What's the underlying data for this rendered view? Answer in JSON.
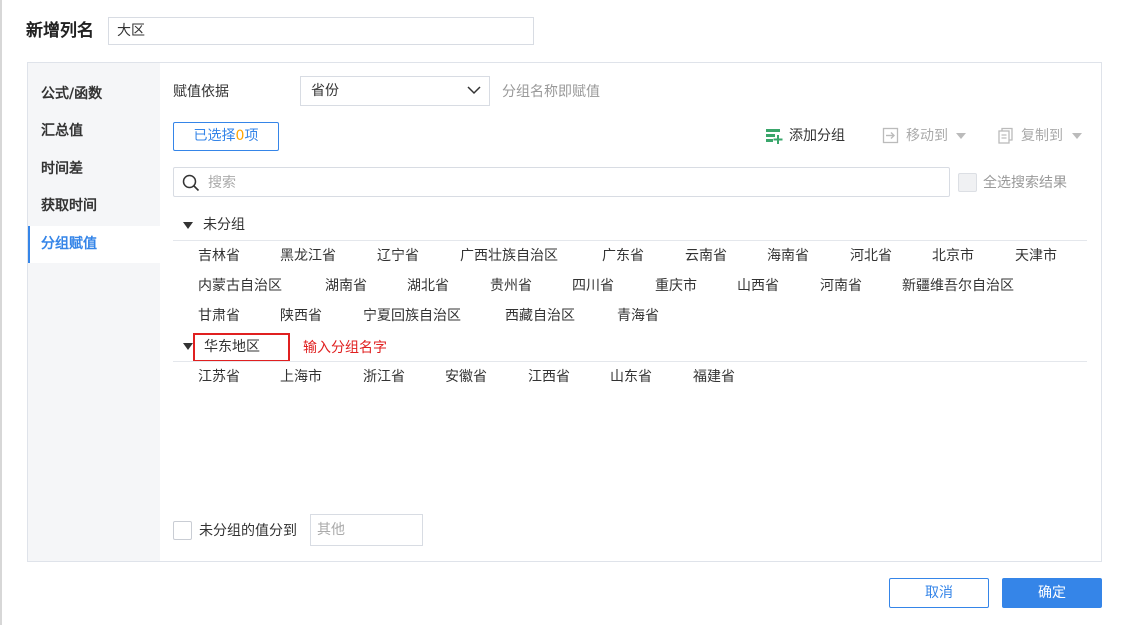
{
  "header": {
    "label": "新增列名",
    "name_value": "大区"
  },
  "sidebar": {
    "items": [
      {
        "label": "公式/函数"
      },
      {
        "label": "汇总值"
      },
      {
        "label": "时间差"
      },
      {
        "label": "获取时间"
      },
      {
        "label": "分组赋值"
      }
    ],
    "active_index": 4
  },
  "assign": {
    "basis_label": "赋值依据",
    "basis_value": "省份",
    "hint": "分组名称即赋值"
  },
  "toolbar": {
    "selected_prefix": "已选择",
    "selected_count": "0",
    "selected_suffix": "项",
    "add_group": "添加分组",
    "move_to": "移动到",
    "copy_to": "复制到"
  },
  "search": {
    "placeholder": "搜索",
    "select_all_results": "全选搜索结果"
  },
  "groups": [
    {
      "title": "未分组",
      "items": [
        "吉林省",
        "黑龙江省",
        "辽宁省",
        "广西壮族自治区",
        "广东省",
        "云南省",
        "海南省",
        "河北省",
        "北京市",
        "天津市",
        "内蒙古自治区",
        "湖南省",
        "湖北省",
        "贵州省",
        "四川省",
        "重庆市",
        "山西省",
        "河南省",
        "新疆维吾尔自治区",
        "甘肃省",
        "陕西省",
        "宁夏回族自治区",
        "西藏自治区",
        "青海省"
      ]
    },
    {
      "title": "华东地区",
      "annotation": "输入分组名字",
      "items": [
        "江苏省",
        "上海市",
        "浙江省",
        "安徽省",
        "江西省",
        "山东省",
        "福建省"
      ]
    }
  ],
  "footer_option": {
    "label": "未分组的值分到",
    "placeholder": "其他"
  },
  "buttons": {
    "cancel": "取消",
    "confirm": "确定"
  },
  "colors": {
    "accent": "#3585e8",
    "count": "#ffa500",
    "annotation": "#e02020",
    "add_icon": "#3aa66b"
  }
}
